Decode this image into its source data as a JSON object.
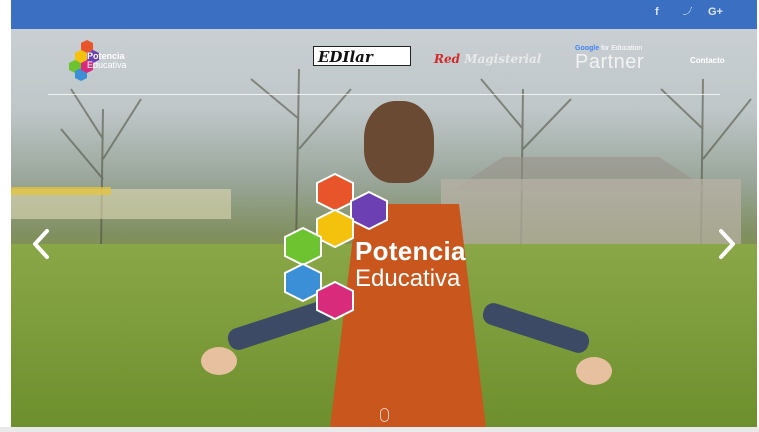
{
  "social": {
    "facebook": "f",
    "twitter": "🐦",
    "googleplus": "G+"
  },
  "nav": {
    "logo_small": {
      "line1": "Potencia",
      "line2": "Educativa"
    },
    "partners": {
      "edilar": "EDIlar",
      "red_magisterial": {
        "red": "Red",
        "rest": "Magisterial"
      },
      "google_education": {
        "google": "Google",
        "suffix": "for Education",
        "partner": "Partner"
      }
    },
    "contact_label": "Contacto"
  },
  "hero": {
    "title_line1": "Potencia",
    "title_line2": "Educativa",
    "slide_indicator": ""
  },
  "colors": {
    "topbar": "#3b6fc1",
    "hex": [
      "#e9552b",
      "#6c3fb3",
      "#f4c20d",
      "#6ec430",
      "#3a8fd6",
      "#d92b7b"
    ]
  },
  "icons": {
    "prev": "chevron-left-icon",
    "next": "chevron-right-icon"
  }
}
